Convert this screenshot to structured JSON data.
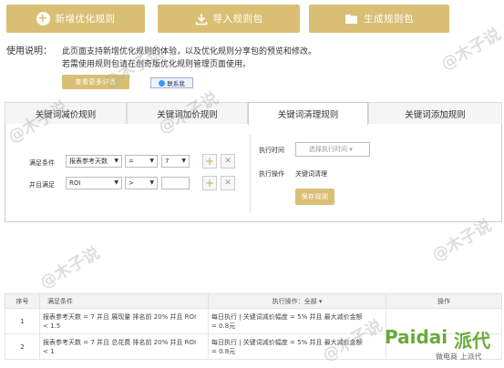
{
  "toolbar": {
    "add_label": "新增优化规则",
    "import_label": "导入规则包",
    "generate_label": "生成规则包"
  },
  "usage": {
    "title": "使用说明：",
    "line1": "此页面支持新增优化规则的体验，以及优化规则分享包的预览和修改。",
    "line2": "若需使用规则包请在创奇版优化规则管理页面使用。",
    "more_button": "查看更多详情",
    "contact_button": "联系我"
  },
  "tabs": [
    "关键词减价规则",
    "关键词加价规则",
    "关键词清理规则",
    "关键词添加规则"
  ],
  "active_tab": 2,
  "form": {
    "cond_label": "满足条件",
    "cond_field": "报表参考天数",
    "cond_op": "=",
    "cond_value": "7",
    "and_label": "并且满足",
    "and_field": "ROI",
    "and_op": ">",
    "and_value": "",
    "add_symbol": "+",
    "remove_symbol": "✕",
    "exec_time_label": "执行时间",
    "exec_time_placeholder": "选择执行时间 ▾",
    "exec_op_label": "执行操作",
    "exec_op_value": "关键词清理",
    "save_button": "保存规则"
  },
  "table": {
    "headers": [
      "序号",
      "满足条件",
      "执行操作：全部 ▾",
      "操作"
    ],
    "rows": [
      {
        "num": "1",
        "cond1": "报表参考天数 = 7 并且 展现量 排名前 20% 并且 ROI",
        "cond2": "< 1.5",
        "op1": "每日执行 | 关键词减价幅度 = 5% 并且 最大减价金额",
        "op2": "= 0.8元"
      },
      {
        "num": "2",
        "cond1": "报表参考天数 = 7 并且 总花费 排名前 20% 并且 ROI",
        "cond2": "< 1",
        "op1": "每日执行 | 关键词减价幅度 = 5% 并且 最大减价金额",
        "op2": "= 0.8元"
      }
    ]
  },
  "watermarks": {
    "wm": "@木子说",
    "brand": "Paidai",
    "brand_cn": "派代",
    "brand_sub": "做电商 上派代"
  },
  "colors": {
    "gold": "#d9bf73",
    "brand_green": "#6aa93a"
  }
}
